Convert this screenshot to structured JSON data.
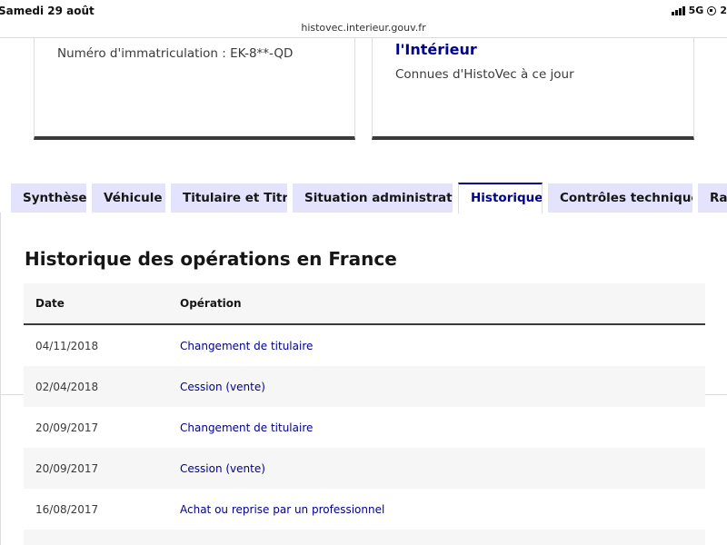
{
  "status_bar": {
    "date": "Samedi 29 août",
    "network": "5G",
    "clock_partial": "2"
  },
  "browser": {
    "url": "histovec.interieur.gouv.fr"
  },
  "cards": {
    "left": {
      "plate": "Numéro d'immatriculation : EK-8**-QD"
    },
    "right": {
      "title": "l'Intérieur",
      "subtitle": "Connues d'HistoVec à ce jour"
    }
  },
  "tabs": [
    {
      "label": "Synthèse"
    },
    {
      "label": "Véhicule"
    },
    {
      "label": "Titulaire et Titre"
    },
    {
      "label": "Situation administrative"
    },
    {
      "label": "Historique"
    },
    {
      "label": "Contrôles techniques"
    },
    {
      "label": "Rap"
    }
  ],
  "panel": {
    "title": "Historique des opérations en France",
    "columns": {
      "date": "Date",
      "operation": "Opération"
    },
    "rows": [
      {
        "date": "04/11/2018",
        "operation": "Changement de titulaire"
      },
      {
        "date": "02/04/2018",
        "operation": "Cession (vente)"
      },
      {
        "date": "20/09/2017",
        "operation": "Changement de titulaire"
      },
      {
        "date": "20/09/2017",
        "operation": "Cession (vente)"
      },
      {
        "date": "16/08/2017",
        "operation": "Achat ou reprise par un professionnel"
      }
    ]
  },
  "colors": {
    "accent": "#000091",
    "tab_bg": "#e3e3fd",
    "row_alt": "#f6f6f6"
  }
}
